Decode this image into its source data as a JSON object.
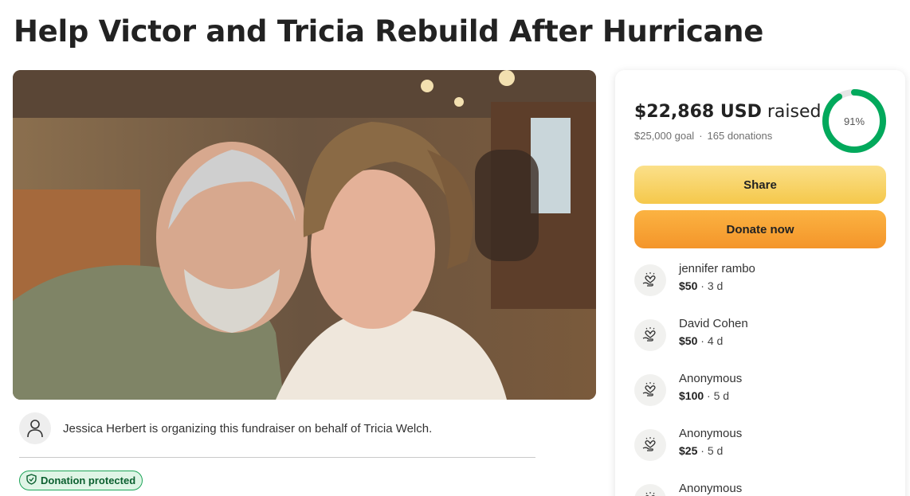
{
  "page": {
    "title": "Help Victor and Tricia Rebuild After Hurricane"
  },
  "organizer": {
    "text": "Jessica Herbert is organizing this fundraiser on behalf of Tricia Welch."
  },
  "badge": {
    "label": "Donation protected"
  },
  "card": {
    "raised_amount": "$22,868 USD",
    "raised_suffix": " raised",
    "goal": "$25,000 goal",
    "donations_count": "165 donations",
    "progress_label": "91%",
    "progress_fraction": 0.91,
    "share_label": "Share",
    "donate_label": "Donate now"
  },
  "donations": [
    {
      "name": "jennifer rambo",
      "amount": "$50",
      "age": "3 d"
    },
    {
      "name": "David Cohen",
      "amount": "$50",
      "age": "4 d"
    },
    {
      "name": "Anonymous",
      "amount": "$100",
      "age": "5 d"
    },
    {
      "name": "Anonymous",
      "amount": "$25",
      "age": "5 d"
    },
    {
      "name": "Anonymous"
    }
  ],
  "colors": {
    "progress": "#02a95c",
    "share_button": "#f5c84b",
    "donate_button": "#f4952a",
    "badge_border": "#1da458"
  },
  "icons": {
    "organizer_avatar": "user-icon",
    "badge": "shield-icon",
    "donation": "heart-hand-icon"
  }
}
